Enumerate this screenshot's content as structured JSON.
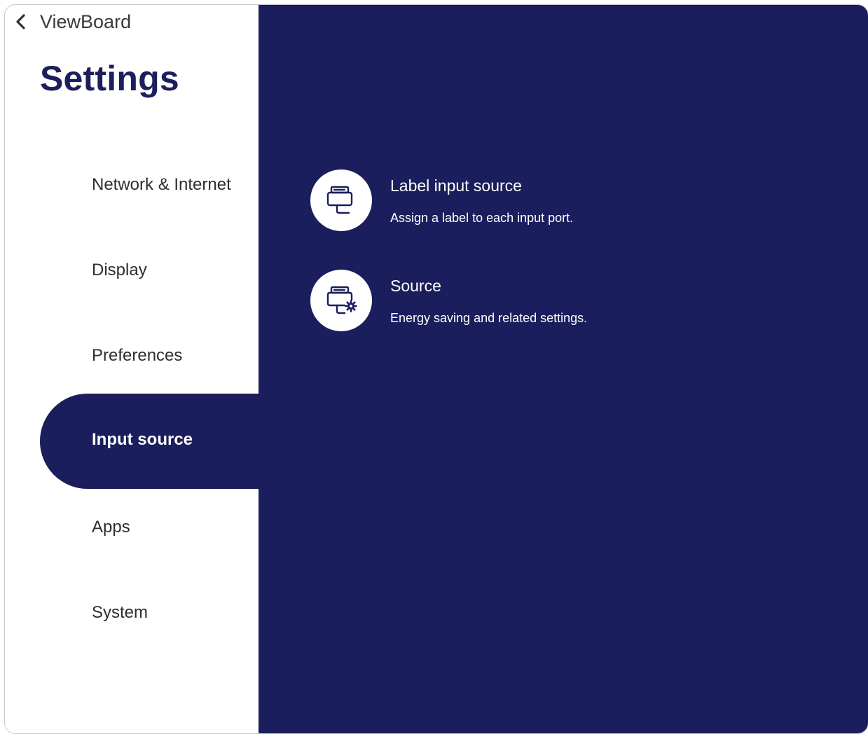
{
  "header": {
    "back_label": "ViewBoard",
    "title": "Settings"
  },
  "sidebar": {
    "items": [
      {
        "label": "Network & Internet"
      },
      {
        "label": "Display"
      },
      {
        "label": "Preferences"
      },
      {
        "label": "Input source",
        "active": true
      },
      {
        "label": "Apps"
      },
      {
        "label": "System"
      }
    ]
  },
  "main": {
    "options": [
      {
        "title": "Label input source",
        "description": "Assign a label to each input port.",
        "icon": "input-port-icon"
      },
      {
        "title": "Source",
        "description": "Energy saving and related settings.",
        "icon": "input-port-settings-icon"
      }
    ]
  },
  "colors": {
    "accent": "#1b1e5c",
    "title": "#1c1f5b",
    "panel_text": "#ffffff"
  }
}
